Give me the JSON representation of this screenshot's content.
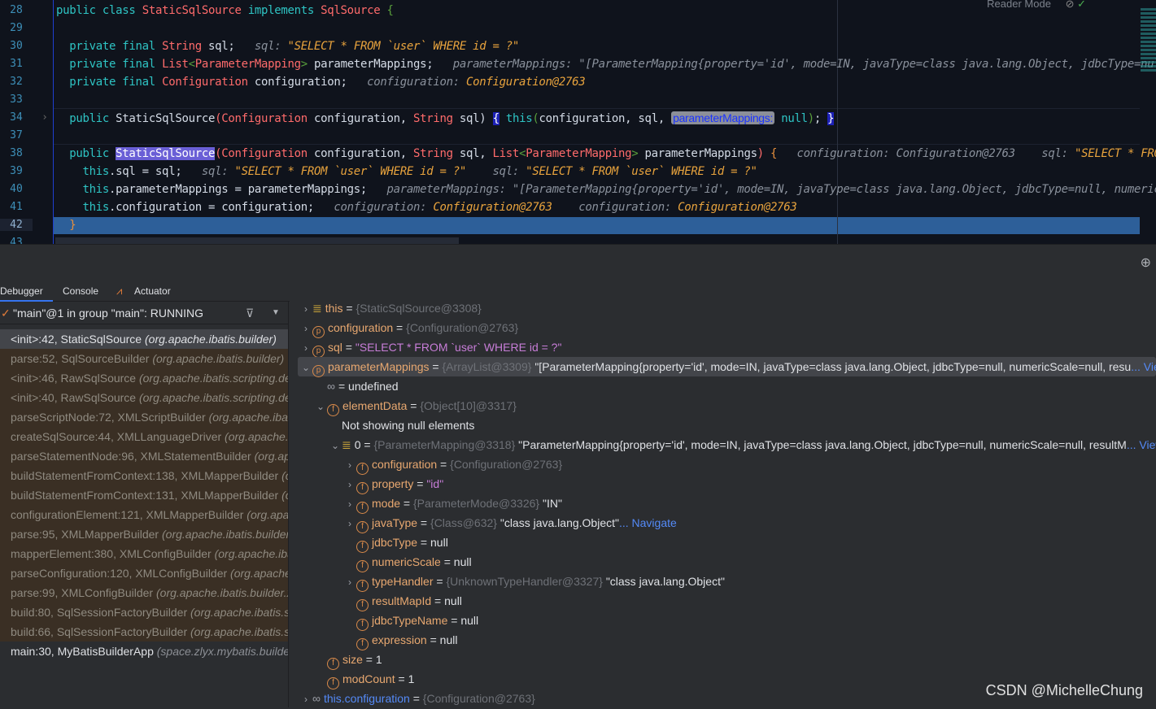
{
  "editor": {
    "reader_mode": "Reader Mode",
    "lines": [
      {
        "n": "28",
        "segs": [
          [
            "kw",
            "public class "
          ],
          [
            "ty",
            "StaticSqlSource"
          ],
          [
            "kw",
            " implements "
          ],
          [
            "ty",
            "SqlSource"
          ],
          [
            "br",
            " {"
          ]
        ]
      },
      {
        "n": "29",
        "segs": []
      },
      {
        "n": "30",
        "segs": [
          [
            "kw",
            "  private final "
          ],
          [
            "ty",
            "String"
          ],
          [
            "id",
            " sql;"
          ],
          [
            "hint",
            "   sql: "
          ],
          [
            "hs",
            "\"SELECT * FROM `user` WHERE id = ?\""
          ]
        ]
      },
      {
        "n": "31",
        "segs": [
          [
            "kw",
            "  private final "
          ],
          [
            "ty",
            "List"
          ],
          [
            "br",
            "<"
          ],
          [
            "ty",
            "ParameterMapping"
          ],
          [
            "br",
            ">"
          ],
          [
            "id",
            " parameterMappings;"
          ],
          [
            "hint",
            "   parameterMappings: \"[ParameterMapping{property='id', mode=IN, javaType=class java.lang.Object, jdbcType=nul"
          ]
        ]
      },
      {
        "n": "32",
        "segs": [
          [
            "kw",
            "  private final "
          ],
          [
            "ty",
            "Configuration"
          ],
          [
            "id",
            " configuration;"
          ],
          [
            "hint",
            "   configuration: "
          ],
          [
            "hs",
            "Configuration@2763"
          ]
        ]
      },
      {
        "n": "33",
        "segs": []
      },
      {
        "n": "34",
        "segs": [
          [
            "kw",
            "  public "
          ],
          [
            "id",
            "StaticSqlSource"
          ],
          [
            "ty",
            "(Configuration"
          ],
          [
            "id",
            " configuration, "
          ],
          [
            "ty",
            "String"
          ],
          [
            "id",
            " sql)"
          ],
          [
            "pu",
            " "
          ],
          [
            "brace",
            "{"
          ],
          [
            "pu",
            " "
          ],
          [
            "kw",
            "this"
          ],
          [
            "br",
            "("
          ],
          [
            "id",
            "configuration, sql, "
          ],
          [
            "param",
            "parameterMappings:"
          ],
          [
            "nul",
            " null"
          ],
          [
            "br",
            ")"
          ],
          [
            "id",
            ";"
          ],
          [
            "pu",
            " "
          ],
          [
            "brace",
            "}"
          ]
        ]
      },
      {
        "n": "37",
        "segs": []
      },
      {
        "n": "38",
        "segs": [
          [
            "kw",
            "  public "
          ],
          [
            "sel",
            "StaticSqlSource"
          ],
          [
            "ty",
            "(Configuration"
          ],
          [
            "id",
            " configuration, "
          ],
          [
            "ty",
            "String"
          ],
          [
            "id",
            " sql, "
          ],
          [
            "ty",
            "List"
          ],
          [
            "br",
            "<"
          ],
          [
            "ty",
            "ParameterMapping"
          ],
          [
            "br",
            ">"
          ],
          [
            "id",
            " parameterMappings"
          ],
          [
            "ty",
            ")"
          ],
          [
            "org",
            " {"
          ],
          [
            "hint",
            "   configuration: Configuration@2763    sql: "
          ],
          [
            "hs",
            "\"SELECT * FRO"
          ]
        ]
      },
      {
        "n": "39",
        "segs": [
          [
            "kw",
            "    this"
          ],
          [
            "id",
            ".sql = sql;"
          ],
          [
            "hint",
            "   sql: "
          ],
          [
            "hs",
            "\"SELECT * FROM `user` WHERE id = ?\""
          ],
          [
            "hint",
            "    sql: "
          ],
          [
            "hs",
            "\"SELECT * FROM `user` WHERE id = ?\""
          ]
        ]
      },
      {
        "n": "40",
        "segs": [
          [
            "kw",
            "    this"
          ],
          [
            "id",
            ".parameterMappings = parameterMappings;"
          ],
          [
            "hint",
            "   parameterMappings: \"[ParameterMapping{property='id', mode=IN, javaType=class java.lang.Object, jdbcType=null, numeric"
          ]
        ]
      },
      {
        "n": "41",
        "segs": [
          [
            "kw",
            "    this"
          ],
          [
            "id",
            ".configuration = configuration;"
          ],
          [
            "hint",
            "   configuration: "
          ],
          [
            "hs",
            "Configuration@2763"
          ],
          [
            "hint",
            "    configuration: "
          ],
          [
            "hs",
            "Configuration@2763"
          ]
        ]
      },
      {
        "n": "42",
        "segs": [
          [
            "org",
            "  }"
          ]
        ]
      },
      {
        "n": "43",
        "segs": []
      }
    ]
  },
  "tabs": [
    {
      "label": "Debugger"
    },
    {
      "label": "Console"
    },
    {
      "label": "Actuator"
    }
  ],
  "thread": "\"main\"@1 in group \"main\": RUNNING",
  "frames": [
    {
      "m": "<init>:42, StaticSqlSource",
      "p": "(org.apache.ibatis.builder)"
    },
    {
      "m": "parse:52, SqlSourceBuilder",
      "p": "(org.apache.ibatis.builder)"
    },
    {
      "m": "<init>:46, RawSqlSource",
      "p": "(org.apache.ibatis.scripting.defaults)"
    },
    {
      "m": "<init>:40, RawSqlSource",
      "p": "(org.apache.ibatis.scripting.defaults)"
    },
    {
      "m": "parseScriptNode:72, XMLScriptBuilder",
      "p": "(org.apache.ibatis.scripting.xmltags)"
    },
    {
      "m": "createSqlSource:44, XMLLanguageDriver",
      "p": "(org.apache.ibatis.scripting.xmltags)"
    },
    {
      "m": "parseStatementNode:96, XMLStatementBuilder",
      "p": "(org.apache.ibatis.builder.xml)"
    },
    {
      "m": "buildStatementFromContext:138, XMLMapperBuilder",
      "p": "(org.apache.ibatis.builder.xml)"
    },
    {
      "m": "buildStatementFromContext:131, XMLMapperBuilder",
      "p": "(org.apache.ibatis.builder.xml)"
    },
    {
      "m": "configurationElement:121, XMLMapperBuilder",
      "p": "(org.apache.ibatis.builder.xml)"
    },
    {
      "m": "parse:95, XMLMapperBuilder",
      "p": "(org.apache.ibatis.builder.xml)"
    },
    {
      "m": "mapperElement:380, XMLConfigBuilder",
      "p": "(org.apache.ibatis.builder.xml)"
    },
    {
      "m": "parseConfiguration:120, XMLConfigBuilder",
      "p": "(org.apache.ibatis.builder.xml)"
    },
    {
      "m": "parse:99, XMLConfigBuilder",
      "p": "(org.apache.ibatis.builder.xml)"
    },
    {
      "m": "build:80, SqlSessionFactoryBuilder",
      "p": "(org.apache.ibatis.session)"
    },
    {
      "m": "build:66, SqlSessionFactoryBuilder",
      "p": "(org.apache.ibatis.session)"
    },
    {
      "m": "main:30, MyBatisBuilderApp",
      "p": "(space.zlyx.mybatis.builder)"
    }
  ],
  "variables": [
    {
      "lvl": 0,
      "chev": ">",
      "icon": "list",
      "name": "this",
      "ref": "{StaticSqlSource@3308}"
    },
    {
      "lvl": 0,
      "chev": ">",
      "icon": "p",
      "name": "configuration",
      "ref": "{Configuration@2763}"
    },
    {
      "lvl": 0,
      "chev": ">",
      "icon": "p",
      "name": "sql",
      "str": "\"SELECT * FROM `user` WHERE id = ?\""
    },
    {
      "lvl": 0,
      "chev": "v",
      "icon": "p",
      "name": "parameterMappings",
      "ref": "{ArrayList@3309}",
      "val": "\"[ParameterMapping{property='id', mode=IN, javaType=class java.lang.Object, jdbcType=null, numericScale=null, resu",
      "link": "... View",
      "hl": true
    },
    {
      "lvl": 1,
      "chev": "",
      "icon": "watch",
      "name": "",
      "val": "= undefined",
      "noeq": true
    },
    {
      "lvl": 1,
      "chev": "v",
      "icon": "f",
      "name": "elementData",
      "ref": "{Object[10]@3317}"
    },
    {
      "lvl": 2,
      "chev": "",
      "icon": "",
      "name": "",
      "val": "Not showing null elements",
      "noeq": true
    },
    {
      "lvl": 2,
      "chev": "v",
      "icon": "list",
      "name": "0",
      "ref": "{ParameterMapping@3318}",
      "val": "\"ParameterMapping{property='id', mode=IN, javaType=class java.lang.Object, jdbcType=null, numericScale=null, resultM",
      "link": "... View"
    },
    {
      "lvl": 3,
      "chev": ">",
      "icon": "f",
      "name": "configuration",
      "ref": "{Configuration@2763}"
    },
    {
      "lvl": 3,
      "chev": ">",
      "icon": "f",
      "name": "property",
      "str": "\"id\""
    },
    {
      "lvl": 3,
      "chev": ">",
      "icon": "f",
      "name": "mode",
      "ref": "{ParameterMode@3326}",
      "val": "\"IN\""
    },
    {
      "lvl": 3,
      "chev": ">",
      "icon": "f",
      "name": "javaType",
      "ref": "{Class@632}",
      "val": "\"class java.lang.Object\"",
      "link": "... Navigate"
    },
    {
      "lvl": 3,
      "chev": "",
      "icon": "f",
      "name": "jdbcType",
      "val": "null"
    },
    {
      "lvl": 3,
      "chev": "",
      "icon": "f",
      "name": "numericScale",
      "val": "null"
    },
    {
      "lvl": 3,
      "chev": ">",
      "icon": "f",
      "name": "typeHandler",
      "ref": "{UnknownTypeHandler@3327}",
      "val": "\"class java.lang.Object\""
    },
    {
      "lvl": 3,
      "chev": "",
      "icon": "f",
      "name": "resultMapId",
      "val": "null"
    },
    {
      "lvl": 3,
      "chev": "",
      "icon": "f",
      "name": "jdbcTypeName",
      "val": "null"
    },
    {
      "lvl": 3,
      "chev": "",
      "icon": "f",
      "name": "expression",
      "val": "null"
    },
    {
      "lvl": 1,
      "chev": "",
      "icon": "f",
      "name": "size",
      "val": "1"
    },
    {
      "lvl": 1,
      "chev": "",
      "icon": "f",
      "name": "modCount",
      "val": "1"
    },
    {
      "lvl": 0,
      "chev": ">",
      "icon": "watch",
      "name": "this.configuration",
      "ref": "{Configuration@2763}",
      "watchname": true
    }
  ],
  "watermark": "CSDN @MichelleChung"
}
